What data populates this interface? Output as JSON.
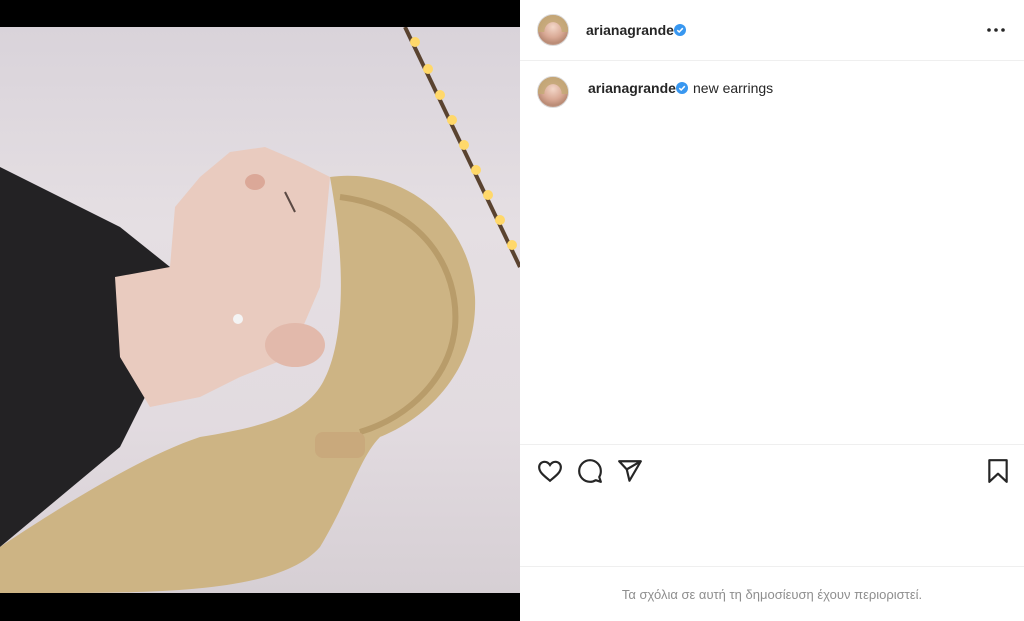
{
  "post": {
    "username": "arianagrande",
    "verified": true,
    "caption": "new earrings",
    "comments_restricted_text": "Τα σχόλια σε αυτή τη δημοσίευση έχουν περιοριστεί."
  },
  "icons": {
    "more": "more-options-icon",
    "like": "heart-icon",
    "comment": "comment-icon",
    "share": "share-icon",
    "save": "bookmark-icon",
    "verified": "verified-badge-icon"
  },
  "colors": {
    "verified": "#3897f0",
    "text": "#262626",
    "muted": "#8e8e8e",
    "divider": "#efefef"
  }
}
